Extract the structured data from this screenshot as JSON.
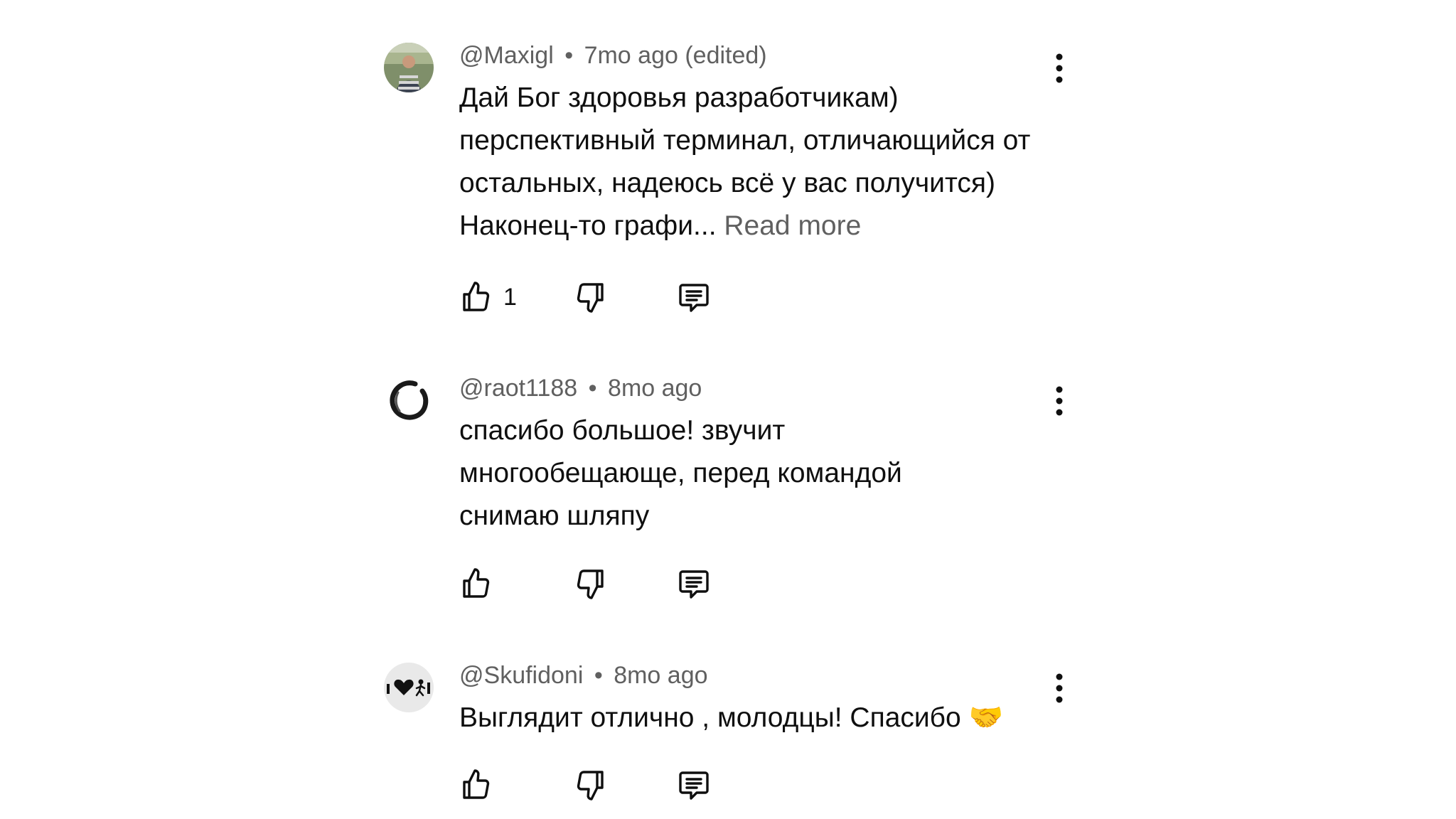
{
  "comments": [
    {
      "author": "@Maxigl",
      "separator": "•",
      "time": "7mo ago (edited)",
      "text": "Дай Бог здоровья разработчикам) перспективный терминал, отличающийся от остальных, надеюсь всё у вас получится) Наконец-то графи...",
      "read_more": "Read more",
      "like_count": "1",
      "avatar_icon": "photo-avatar"
    },
    {
      "author": "@raot1188",
      "separator": "•",
      "time": "8mo ago",
      "text": "спасибо большое! звучит многообещающе, перед командой снимаю шляпу",
      "like_count": "",
      "avatar_icon": "enso-circle-avatar"
    },
    {
      "author": "@Skufidoni",
      "separator": "•",
      "time": "8mo ago",
      "text": "Выглядит отлично , молодцы! Спасибо 🤝",
      "like_count": "",
      "avatar_icon": "heart-logo-avatar"
    }
  ],
  "icons": {
    "like": "thumbs-up-icon",
    "dislike": "thumbs-down-icon",
    "reply": "reply-comment-icon",
    "menu": "more-vertical-icon"
  },
  "colors": {
    "text": "#0f0f0f",
    "meta": "#606060"
  }
}
